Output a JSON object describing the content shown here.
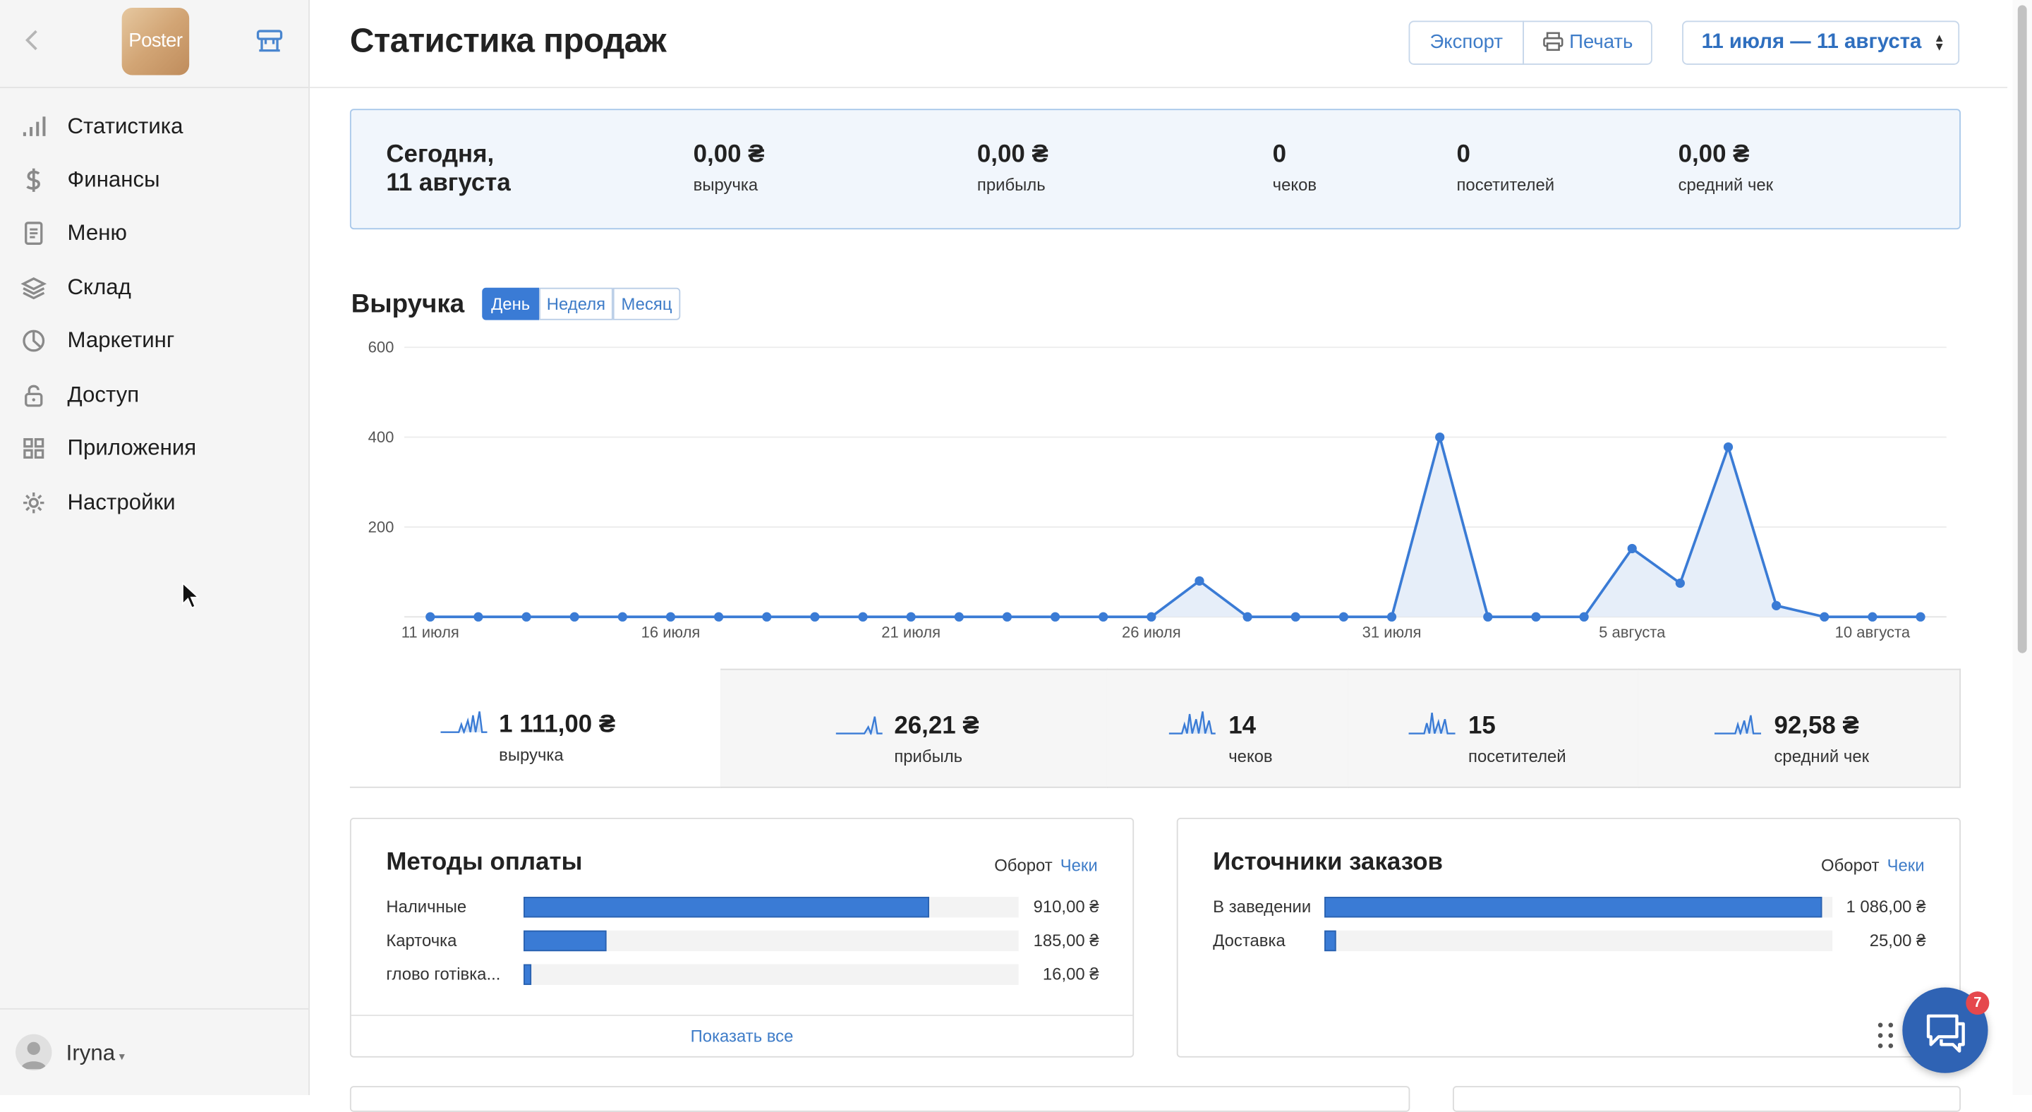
{
  "sidebar": {
    "logo_text": "Poster",
    "items": [
      {
        "label": "Статистика",
        "icon": "bar-chart-icon"
      },
      {
        "label": "Финансы",
        "icon": "dollar-icon"
      },
      {
        "label": "Меню",
        "icon": "document-icon"
      },
      {
        "label": "Склад",
        "icon": "layers-icon"
      },
      {
        "label": "Маркетинг",
        "icon": "pie-icon"
      },
      {
        "label": "Доступ",
        "icon": "lock-icon"
      },
      {
        "label": "Приложения",
        "icon": "grid-icon"
      },
      {
        "label": "Настройки",
        "icon": "gear-icon"
      }
    ],
    "user": {
      "name": "Iryna"
    }
  },
  "header": {
    "title": "Статистика продаж",
    "export_label": "Экспорт",
    "print_label": "Печать",
    "date_range": "11 июля — 11 августа"
  },
  "today": {
    "label_line1": "Сегодня,",
    "label_line2": "11 августа",
    "stats": [
      {
        "value": "0,00 ₴",
        "label": "выручка"
      },
      {
        "value": "0,00 ₴",
        "label": "прибыль"
      },
      {
        "value": "0",
        "label": "чеков"
      },
      {
        "value": "0",
        "label": "посетителей"
      },
      {
        "value": "0,00 ₴",
        "label": "средний чек"
      }
    ]
  },
  "revenue": {
    "title": "Выручка",
    "periods": [
      "День",
      "Неделя",
      "Месяц"
    ],
    "active_period": "День"
  },
  "chart_data": {
    "type": "area",
    "title": "Выручка",
    "x_labels": [
      "11 июля",
      "16 июля",
      "21 июля",
      "26 июля",
      "31 июля",
      "5 августа",
      "10 августа"
    ],
    "x_label_indices": [
      0,
      5,
      10,
      15,
      20,
      25,
      30
    ],
    "y_ticks": [
      200,
      400,
      600
    ],
    "ylim": [
      0,
      600
    ],
    "values": [
      0,
      0,
      0,
      0,
      0,
      0,
      0,
      0,
      0,
      0,
      0,
      0,
      0,
      0,
      0,
      0,
      80,
      0,
      0,
      0,
      0,
      400,
      0,
      0,
      0,
      152,
      75,
      378,
      25,
      0,
      0,
      0
    ],
    "color": "#3a7bd5",
    "fill": "#e6eef9",
    "grid": true
  },
  "summary": [
    {
      "value": "1 111,00 ₴",
      "label": "выручка",
      "active": true
    },
    {
      "value": "26,21 ₴",
      "label": "прибыль",
      "active": false
    },
    {
      "value": "14",
      "label": "чеков",
      "active": false
    },
    {
      "value": "15",
      "label": "посетителей",
      "active": false
    },
    {
      "value": "92,58 ₴",
      "label": "средний чек",
      "active": false
    }
  ],
  "payment_methods": {
    "title": "Методы оплаты",
    "tab_turnover": "Оборот",
    "tab_checks": "Чеки",
    "rows": [
      {
        "label": "Наличные",
        "value": "910,00 ₴",
        "fraction": 0.82
      },
      {
        "label": "Карточка",
        "value": "185,00 ₴",
        "fraction": 0.167
      },
      {
        "label": "глово готівка...",
        "value": "16,00 ₴",
        "fraction": 0.015
      }
    ],
    "show_all": "Показать все"
  },
  "order_sources": {
    "title": "Источники заказов",
    "tab_turnover": "Оборот",
    "tab_checks": "Чеки",
    "rows": [
      {
        "label": "В заведении",
        "value": "1 086,00 ₴",
        "fraction": 0.98
      },
      {
        "label": "Доставка",
        "value": "25,00 ₴",
        "fraction": 0.023
      }
    ]
  },
  "chat": {
    "badge": "7"
  }
}
